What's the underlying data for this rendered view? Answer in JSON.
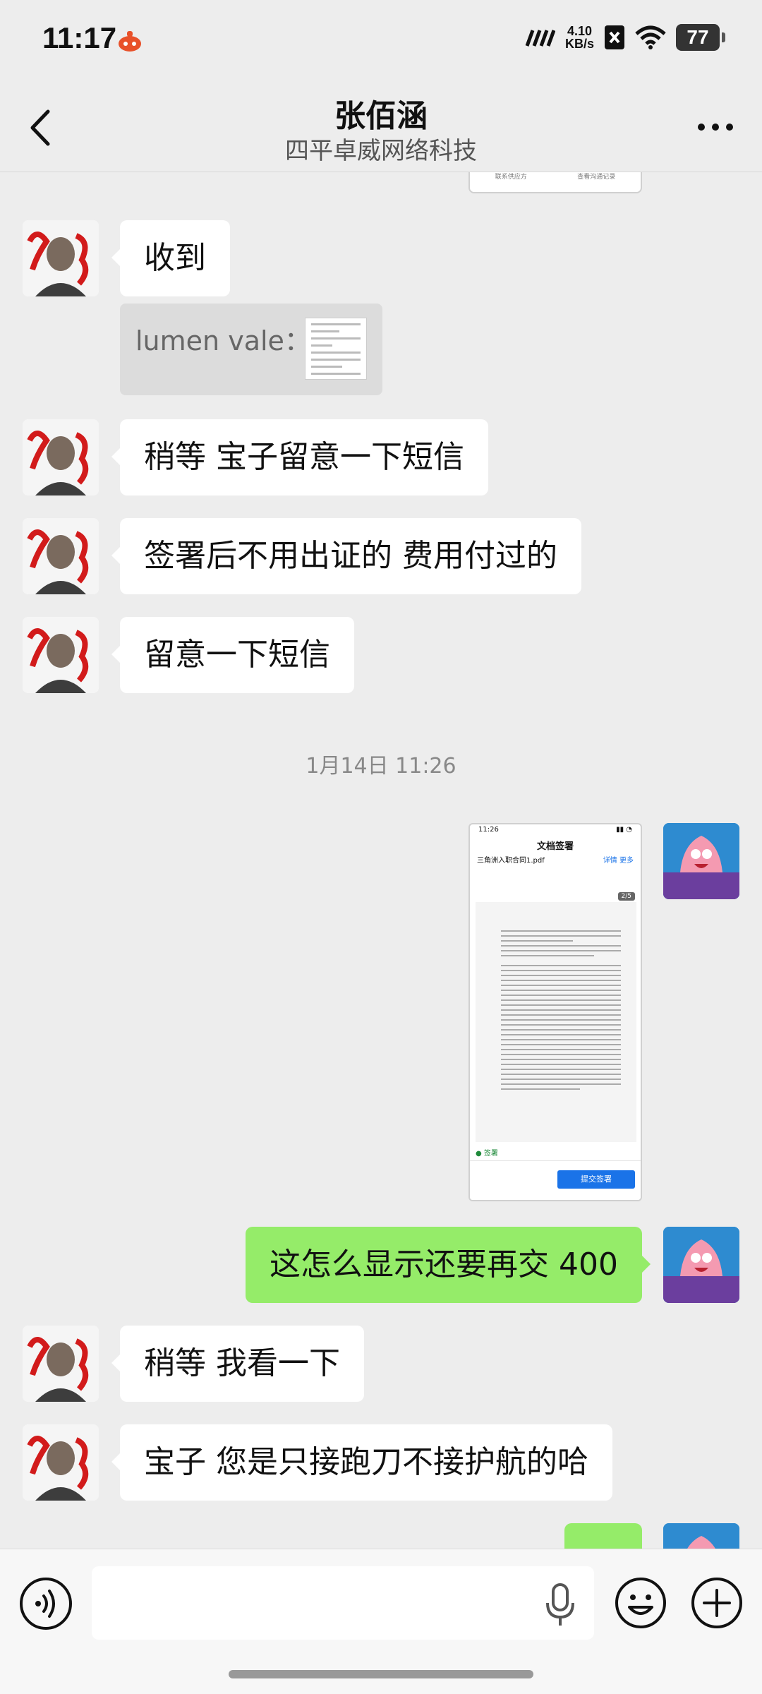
{
  "status_bar": {
    "time": "11:17",
    "net_speed_value": "4.10",
    "net_speed_unit": "KB/s",
    "battery": "77",
    "icons": [
      "app-notification-icon",
      "signal-icon",
      "no-sim-icon",
      "wifi-icon",
      "battery-icon"
    ]
  },
  "header": {
    "title": "张佰涵",
    "subtitle": "四平卓威网络科技",
    "back_icon": "chevron-left-icon",
    "more_icon": "more-horizontal-icon"
  },
  "chat": {
    "top_file_card": {
      "left_text": "联系供应方",
      "right_text": "查看沟通记录"
    },
    "quote": {
      "sender": "lumen vale："
    },
    "messages": [
      {
        "side": "left",
        "text": "收到"
      },
      {
        "side": "left",
        "text": "稍等 宝子留意一下短信"
      },
      {
        "side": "left",
        "text": "签署后不用出证的 费用付过的"
      },
      {
        "side": "left",
        "text": "留意一下短信"
      },
      {
        "side": "right",
        "text": "这怎么显示还要再交 400"
      },
      {
        "side": "left",
        "text": "稍等 我看一下"
      },
      {
        "side": "left",
        "text": "宝子 您是只接跑刀不接护航的哈"
      }
    ],
    "timestamp": "1月14日 11:26",
    "screenshot": {
      "time": "11:26",
      "title": "文档签署",
      "file_name": "三角洲入职合同1.pdf",
      "file_links": "详情  更多",
      "page_indicator": "2/5",
      "checkbox_label": "签署",
      "submit_label": "提交签署"
    }
  },
  "input_bar": {
    "placeholder": "",
    "icons": [
      "voice-icon",
      "mic-icon",
      "emoji-icon",
      "plus-icon"
    ]
  },
  "colors": {
    "background": "#ededed",
    "sent_bubble": "#95ec69",
    "received_bubble": "#ffffff",
    "accent_blue": "#1a73e8"
  }
}
